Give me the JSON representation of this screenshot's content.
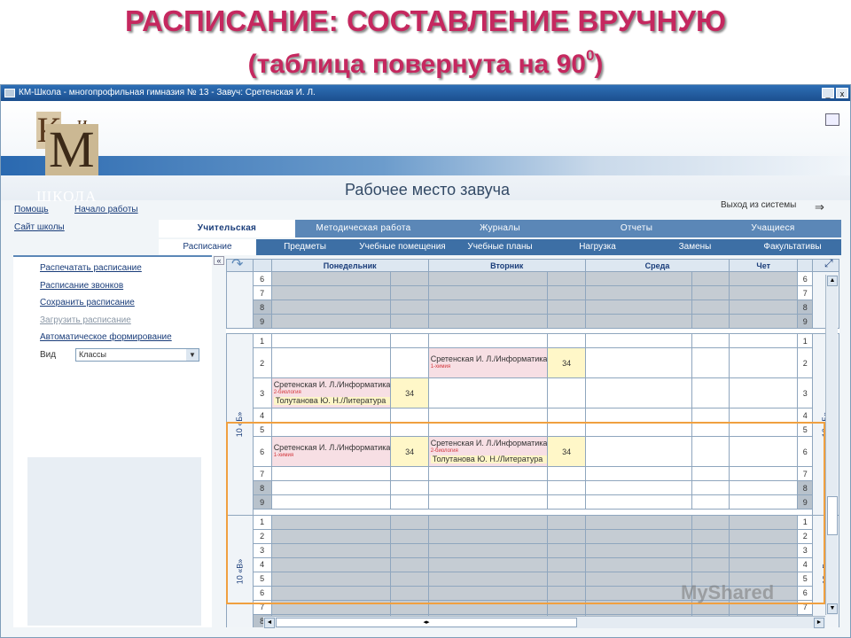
{
  "slide": {
    "title_line1": "РАСПИСАНИЕ: СОСТАВЛЕНИЕ ВРУЧНУЮ",
    "title_line2": "(таблица повернута на 90",
    "title_sup": "0",
    "title_close": ")"
  },
  "window": {
    "title": "КМ-Школа - многопрофильная гимназия № 13 - Завуч: Сретенская И. Л.",
    "min_label": "_",
    "max_label": "x"
  },
  "banner": {
    "logo_k": "К",
    "logo_i": "и",
    "logo_m": "М",
    "logo_school": "ШКОЛА",
    "workspace_title": "Рабочее место завуча",
    "exit_label": "Выход из системы"
  },
  "links": {
    "help": "Помощь",
    "start": "Начало работы",
    "site": "Сайт школы"
  },
  "tabs_primary": [
    {
      "label": "Учительская",
      "active": true
    },
    {
      "label": "Методическая работа",
      "active": false
    },
    {
      "label": "Журналы",
      "active": false
    },
    {
      "label": "Отчеты",
      "active": false
    },
    {
      "label": "Учащиеся",
      "active": false
    }
  ],
  "tabs_secondary": [
    {
      "label": "Расписание",
      "active": true
    },
    {
      "label": "Предметы",
      "active": false
    },
    {
      "label": "Учебные помещения",
      "active": false
    },
    {
      "label": "Учебные планы",
      "active": false
    },
    {
      "label": "Нагрузка",
      "active": false
    },
    {
      "label": "Замены",
      "active": false
    },
    {
      "label": "Факультативы",
      "active": false
    }
  ],
  "sidebar": {
    "items": [
      {
        "label": "Распечатать расписание",
        "enabled": true
      },
      {
        "label": "Расписание звонков",
        "enabled": true
      },
      {
        "label": "Сохранить расписание",
        "enabled": true
      },
      {
        "label": "Загрузить расписание",
        "enabled": false
      },
      {
        "label": "Автоматическое формирование",
        "enabled": true
      }
    ],
    "view_label": "Вид",
    "view_value": "Классы",
    "collapse_label": "«"
  },
  "schedule": {
    "days": [
      "Понедельник",
      "Вторник",
      "Среда",
      "Чет"
    ],
    "classes": [
      "10 «Б»",
      "10 «В»"
    ],
    "lessons": {
      "tue_2_teacher": "Сретенская И. Л./Информатика",
      "tue_2_sub": "1-химия",
      "tue_2_room": "34",
      "mon_3_teacher": "Сретенская И. Л./Информатика",
      "mon_3_sub": "2-биология",
      "mon_3_room": "34",
      "mon_3_second": "Толутанова Ю. Н./Литература",
      "mon_6_teacher": "Сретенская И. Л./Информатика",
      "mon_6_sub": "1-химия",
      "mon_6_room": "34",
      "tue_6_teacher": "Сретенская И. Л./Информатика",
      "tue_6_sub": "2-биология",
      "tue_6_room": "34",
      "tue_6_second": "Толутанова Ю. Н./Литература"
    }
  },
  "scroll": {
    "up": "▲",
    "down": "▼",
    "left": "◄",
    "right": "►",
    "hthumb": "◂▸"
  },
  "watermark": "MyShared"
}
